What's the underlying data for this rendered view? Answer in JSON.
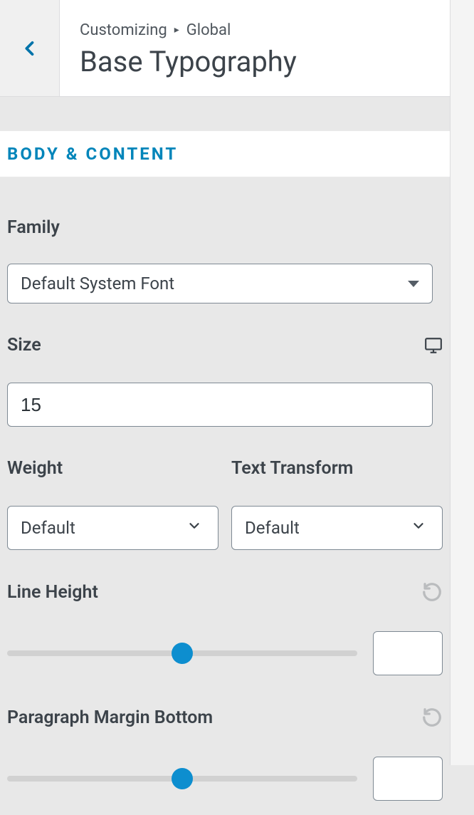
{
  "header": {
    "breadcrumb_prefix": "Customizing",
    "breadcrumb_section": "Global",
    "title": "Base Typography"
  },
  "section": {
    "heading": "BODY & CONTENT"
  },
  "family": {
    "label": "Family",
    "value": "Default System Font"
  },
  "size": {
    "label": "Size",
    "value": "15"
  },
  "weight": {
    "label": "Weight",
    "value": "Default"
  },
  "text_transform": {
    "label": "Text Transform",
    "value": "Default"
  },
  "line_height": {
    "label": "Line Height",
    "value": "",
    "thumb_pct": 50
  },
  "paragraph_margin": {
    "label": "Paragraph Margin Bottom",
    "value": "",
    "thumb_pct": 50
  },
  "colors": {
    "accent": "#0085ba",
    "thumb": "#0d8ecf"
  }
}
